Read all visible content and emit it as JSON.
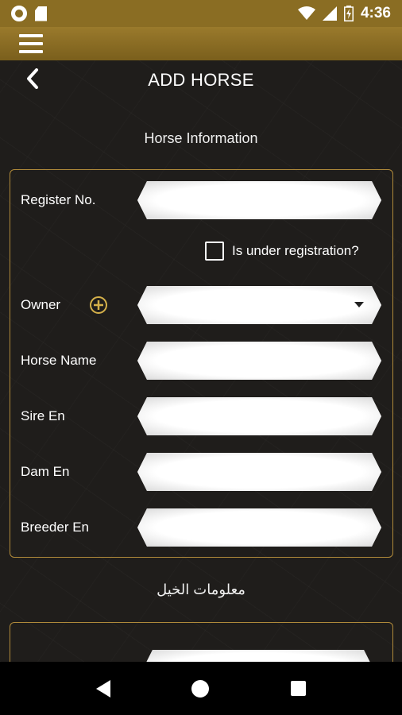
{
  "status_bar": {
    "time": "4:36",
    "icons": [
      "circle-notification-icon",
      "sd-card-icon",
      "wifi-icon",
      "signal-icon",
      "battery-charging-icon"
    ]
  },
  "app_bar": {
    "menu_icon": "hamburger-menu-icon"
  },
  "header": {
    "back_icon": "chevron-left-icon",
    "title": "ADD HORSE"
  },
  "section_en": {
    "title": "Horse Information",
    "fields": {
      "register_no": {
        "label": "Register No.",
        "value": ""
      },
      "under_registration": {
        "label": "Is under registration?",
        "checked": false
      },
      "owner": {
        "label": "Owner",
        "value": "",
        "add_icon": "plus-circle-icon",
        "dropdown_icon": "caret-down-icon"
      },
      "horse_name": {
        "label": "Horse Name",
        "value": ""
      },
      "sire_en": {
        "label": "Sire En",
        "value": ""
      },
      "dam_en": {
        "label": "Dam En",
        "value": ""
      },
      "breeder_en": {
        "label": "Breeder En",
        "value": ""
      }
    }
  },
  "section_ar": {
    "title": "معلومات الخيل"
  },
  "nav_bar": {
    "icons": [
      "back-triangle-icon",
      "home-circle-icon",
      "recents-square-icon"
    ]
  },
  "colors": {
    "accent_gold": "#8a6d23",
    "panel_border": "#b08a3a",
    "background": "#1f1d1b"
  }
}
